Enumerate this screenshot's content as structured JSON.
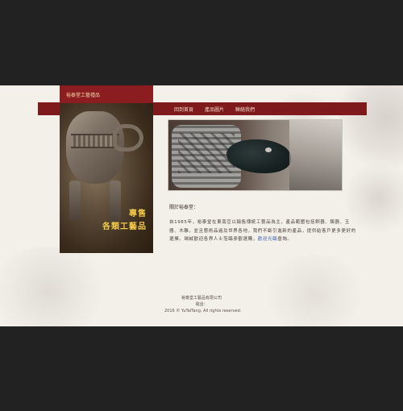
{
  "promo": {
    "header": "裕泰堂工藝禮品",
    "line1": "專售",
    "line2": "各類工藝品"
  },
  "nav": {
    "items": [
      "回到首頁",
      "產品圖片",
      "聯絡我們"
    ]
  },
  "intro": {
    "title": "關於裕泰堂：",
    "para1_a": "自1985年，裕泰堂在東南亞以銷售傳統工藝品為主，",
    "para1_b": "產品範圍包括銅器、錫器、玉器、木雕，並且藝術品遍及世界各地，",
    "para2": "我們不斷引進新的產品，提供給客戶更多更好的選擇。",
    "para3_a": "竭誠歡迎各界人士蒞臨參觀選購，",
    "link_text": "歡迎光臨",
    "para3_b": "垂詢。"
  },
  "footer": {
    "line1": "裕泰堂工藝品有限公司",
    "line2": "電話：",
    "copyright": "2016 © YuTaiTang. All rights reserved."
  }
}
